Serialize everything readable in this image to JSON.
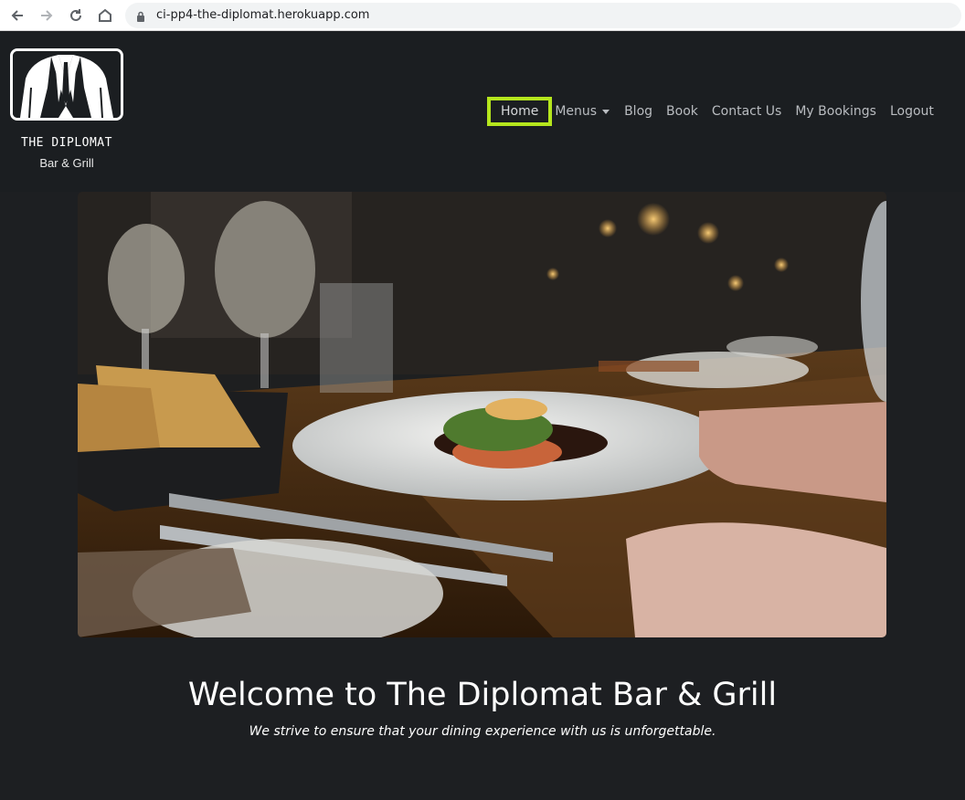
{
  "browser": {
    "url": "ci-pp4-the-diplomat.herokuapp.com"
  },
  "brand": {
    "name": "THE DIPLOMAT",
    "subtitle": "Bar & Grill"
  },
  "nav": {
    "items": [
      {
        "label": "Home",
        "active": true
      },
      {
        "label": "Menus",
        "dropdown": true
      },
      {
        "label": "Blog"
      },
      {
        "label": "Book"
      },
      {
        "label": "Contact Us"
      },
      {
        "label": "My Bookings"
      },
      {
        "label": "Logout"
      }
    ]
  },
  "hero": {
    "heading": "Welcome to The Diplomat Bar & Grill",
    "tagline": "We strive to ensure that your dining experience with us is unforgettable."
  },
  "colors": {
    "page_bg": "#1d1f22",
    "header_bg": "#1b1e21",
    "active_outline": "#b5e61d",
    "nav_text": "#b9bcc0"
  }
}
